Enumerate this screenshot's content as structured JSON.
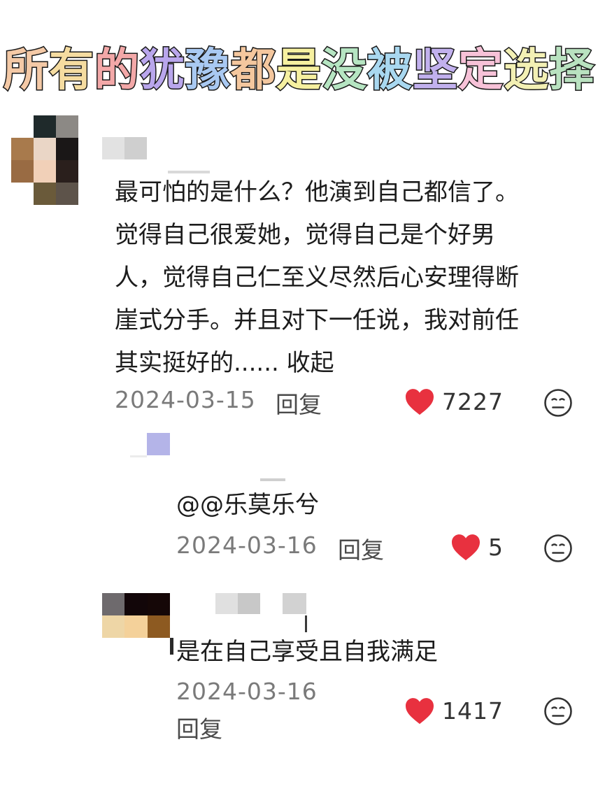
{
  "title": {
    "chars": [
      "所",
      "有",
      "的",
      "犹",
      "豫",
      "都",
      "是",
      "没",
      "被",
      "坚",
      "定",
      "选",
      "择"
    ],
    "colors": [
      "#f4c9a6",
      "#f5dca0",
      "#f3a8a8",
      "#b9a6ec",
      "#a9c9f2",
      "#f4c79e",
      "#f6f0a0",
      "#b6e5c2",
      "#a9d8f0",
      "#c2b1ee",
      "#f7c2d8",
      "#f3f0b4",
      "#b9e2c0"
    ]
  },
  "comments": [
    {
      "text_lines": [
        "最可怕的是什么？他演到自己都信了。",
        "觉得自己很爱她，觉得自己是个好男",
        "人，觉得自己仁至义尽然后心安理得断",
        "崖式分手。并且对下一任说，我对前任",
        "其实挺好的...... 收起"
      ],
      "date": "2024-03-15",
      "reply_label": "回复",
      "likes": "7227"
    },
    {
      "text_lines": [
        "@@乐莫乐兮"
      ],
      "date": "2024-03-16",
      "reply_label": "回复",
      "likes": "5"
    },
    {
      "text_lines": [
        "是在自己享受且自我满足"
      ],
      "date": "2024-03-16",
      "reply_label": "回复",
      "likes": "1417"
    }
  ],
  "colors": {
    "heart": "#e8313f",
    "date": "#7a7a7a",
    "text": "#1c1c1c"
  },
  "icons": [
    "heart-icon",
    "neutral-face-icon"
  ]
}
